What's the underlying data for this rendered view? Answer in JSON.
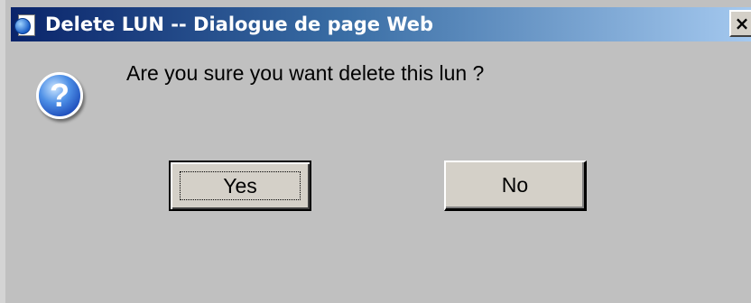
{
  "window": {
    "title": "Delete LUN -- Dialogue de page Web",
    "title_icon": "ie-page-icon",
    "close_label": "×"
  },
  "dialog": {
    "icon": "question-icon",
    "icon_glyph": "?",
    "message": "Are you sure you want delete this lun ?",
    "buttons": {
      "yes_label": "Yes",
      "no_label": "No"
    }
  },
  "colors": {
    "titlebar_start": "#0a246a",
    "titlebar_end": "#a6caf0",
    "background": "#c0c0c0"
  }
}
